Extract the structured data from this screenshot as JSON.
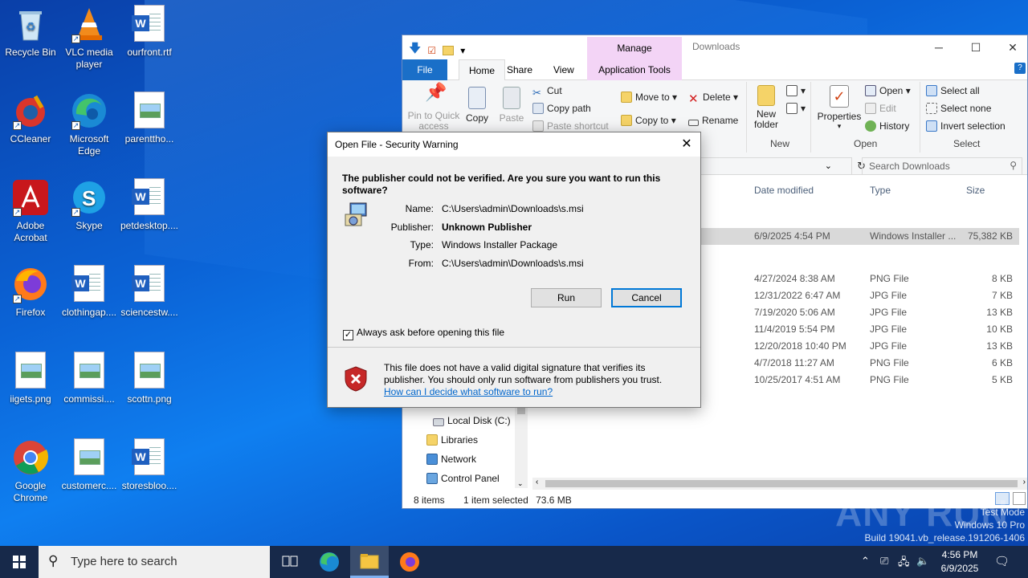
{
  "desktop": {
    "icons": [
      {
        "label": "Recycle Bin",
        "icon": "recycle-bin-icon"
      },
      {
        "label": "VLC media player",
        "icon": "vlc-icon"
      },
      {
        "label": "ourfront.rtf",
        "icon": "word-doc-icon"
      },
      {
        "label": "CCleaner",
        "icon": "ccleaner-icon"
      },
      {
        "label": "Microsoft Edge",
        "icon": "edge-icon"
      },
      {
        "label": "parenttho...",
        "icon": "image-file-icon"
      },
      {
        "label": "Adobe Acrobat",
        "icon": "acrobat-icon"
      },
      {
        "label": "Skype",
        "icon": "skype-icon"
      },
      {
        "label": "petdesktop....",
        "icon": "word-doc-icon"
      },
      {
        "label": "Firefox",
        "icon": "firefox-icon"
      },
      {
        "label": "clothingap....",
        "icon": "word-doc-icon"
      },
      {
        "label": "sciencestw....",
        "icon": "word-doc-icon"
      },
      {
        "label": "iigets.png",
        "icon": "image-file-icon"
      },
      {
        "label": "commissi....",
        "icon": "image-file-icon"
      },
      {
        "label": "scottn.png",
        "icon": "image-file-icon"
      },
      {
        "label": "Google Chrome",
        "icon": "chrome-icon"
      },
      {
        "label": "customerc....",
        "icon": "image-file-icon"
      },
      {
        "label": "storesbloo....",
        "icon": "word-doc-icon"
      }
    ]
  },
  "explorer": {
    "manage_tab": "Manage",
    "window_title": "Downloads",
    "tabs": {
      "file": "File",
      "home": "Home",
      "share": "Share",
      "view": "View",
      "app_tools": "Application Tools"
    },
    "ribbon": {
      "pin": "Pin to Quick access",
      "copy": "Copy",
      "paste": "Paste",
      "cut": "Cut",
      "copy_path": "Copy path",
      "paste_shortcut": "Paste shortcut",
      "move_to": "Move to",
      "copy_to": "Copy to",
      "delete": "Delete",
      "rename": "Rename",
      "new_folder": "New folder",
      "properties": "Properties",
      "open": "Open",
      "edit": "Edit",
      "history": "History",
      "select_all": "Select all",
      "select_none": "Select none",
      "invert_selection": "Invert selection",
      "group_new": "New",
      "group_open": "Open",
      "group_select": "Select"
    },
    "search_placeholder": "Search Downloads",
    "columns": {
      "date": "Date modified",
      "type": "Type",
      "size": "Size"
    },
    "files": [
      {
        "date": "6/9/2025 4:54 PM",
        "type": "Windows Installer ...",
        "size": "75,382 KB",
        "selected": true
      },
      {
        "date": "4/27/2024 8:38 AM",
        "type": "PNG File",
        "size": "8 KB"
      },
      {
        "date": "12/31/2022 6:47 AM",
        "type": "JPG File",
        "size": "7 KB"
      },
      {
        "date": "7/19/2020 5:06 AM",
        "type": "JPG File",
        "size": "13 KB"
      },
      {
        "date": "11/4/2019 5:54 PM",
        "type": "JPG File",
        "size": "10 KB"
      },
      {
        "date": "12/20/2018 10:40 PM",
        "type": "JPG File",
        "size": "13 KB"
      },
      {
        "date": "4/7/2018 11:27 AM",
        "type": "PNG File",
        "size": "6 KB"
      },
      {
        "date": "10/25/2017 4:51 AM",
        "type": "PNG File",
        "size": "5 KB"
      }
    ],
    "nav": {
      "local_disk": "Local Disk (C:)",
      "libraries": "Libraries",
      "network": "Network",
      "control_panel": "Control Panel"
    },
    "status": {
      "items": "8 items",
      "selected": "1 item selected",
      "size": "73.6 MB"
    }
  },
  "dialog": {
    "title": "Open File - Security Warning",
    "question": "The publisher could not be verified.  Are you sure you want to run this software?",
    "name_label": "Name:",
    "name_value": "C:\\Users\\admin\\Downloads\\s.msi",
    "publisher_label": "Publisher:",
    "publisher_value": "Unknown Publisher",
    "type_label": "Type:",
    "type_value": "Windows Installer Package",
    "from_label": "From:",
    "from_value": "C:\\Users\\admin\\Downloads\\s.msi",
    "run": "Run",
    "cancel": "Cancel",
    "checkbox_label": "Always ask before opening this file",
    "warning": "This file does not have a valid digital signature that verifies its publisher.  You should only run software from publishers you trust.",
    "link": "How can I decide what software to run?"
  },
  "taskbar": {
    "search_placeholder": "Type here to search",
    "time": "4:56 PM",
    "date": "6/9/2025"
  },
  "watermark": {
    "line1": "Test Mode",
    "line2": "Windows 10 Pro",
    "line3": "Build 19041.vb_release.191206-1406",
    "brand": "ANY RUN"
  },
  "colors": {
    "accent": "#0078d7",
    "file_tab": "#1a6fc8",
    "manage_tab": "#f3d4f6",
    "taskbar": "#17294a"
  }
}
